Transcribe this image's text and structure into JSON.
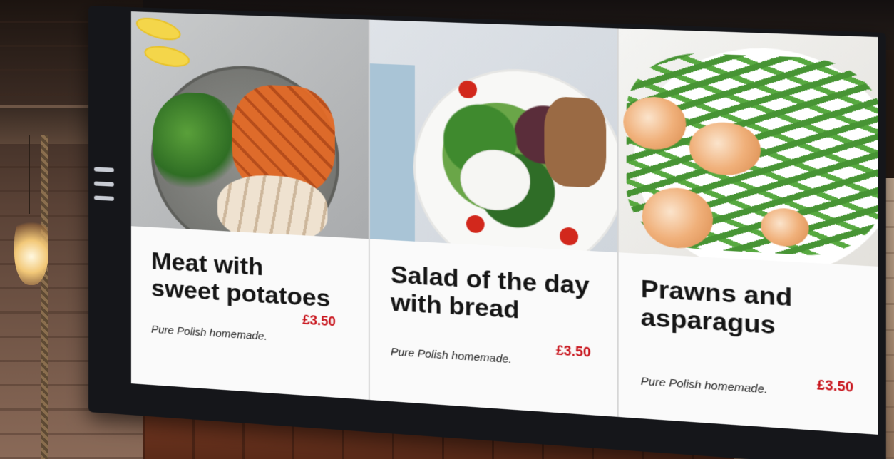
{
  "menu": {
    "items": [
      {
        "title_line1": "Meat with",
        "title_line2": "sweet potatoes",
        "price": "£3.50",
        "subtitle": "Pure Polish homemade."
      },
      {
        "title_line1": "Salad of the day",
        "title_line2": "with bread",
        "price": "£3.50",
        "subtitle": "Pure Polish homemade."
      },
      {
        "title_line1": "Prawns and",
        "title_line2": "asparagus",
        "price": "£3.50",
        "subtitle": "Pure Polish homemade."
      }
    ]
  },
  "colors": {
    "price": "#c8141c",
    "title": "#151515",
    "panel_background": "#fafafa",
    "display_frame": "#15161a"
  }
}
